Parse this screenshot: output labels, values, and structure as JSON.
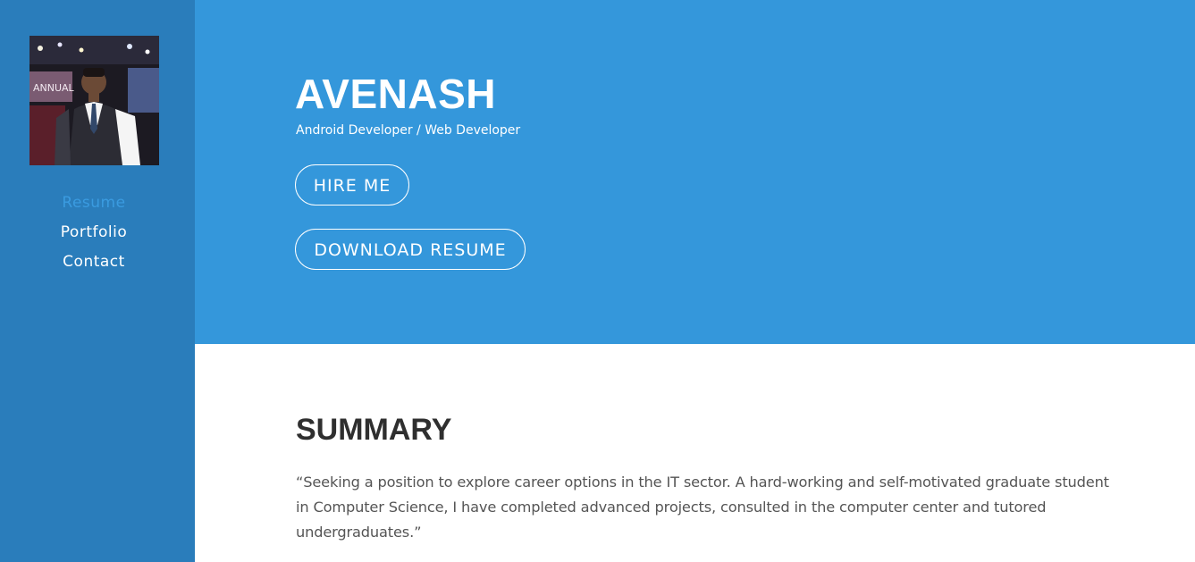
{
  "sidebar": {
    "avatar_icon": "profile-photo",
    "nav": [
      {
        "label": "Resume",
        "active": true
      },
      {
        "label": "Portfolio",
        "active": false
      },
      {
        "label": "Contact",
        "active": false
      }
    ]
  },
  "hero": {
    "name": "AVENASH",
    "subtitle": "Android Developer / Web Developer",
    "hire_label": "HIRE ME",
    "download_label": "DOWNLOAD RESUME"
  },
  "summary": {
    "title": "SUMMARY",
    "text": "“Seeking a position to explore career options in the IT sector. A hard-working and self-motivated graduate student in Computer Science, I have completed advanced projects, consulted in the computer center and tutored undergraduates.”"
  },
  "colors": {
    "sidebar": "#2a7dbb",
    "hero": "#3497db",
    "active_nav": "#3a9be0",
    "heading": "#2f2f2f",
    "body_text": "#555555"
  }
}
